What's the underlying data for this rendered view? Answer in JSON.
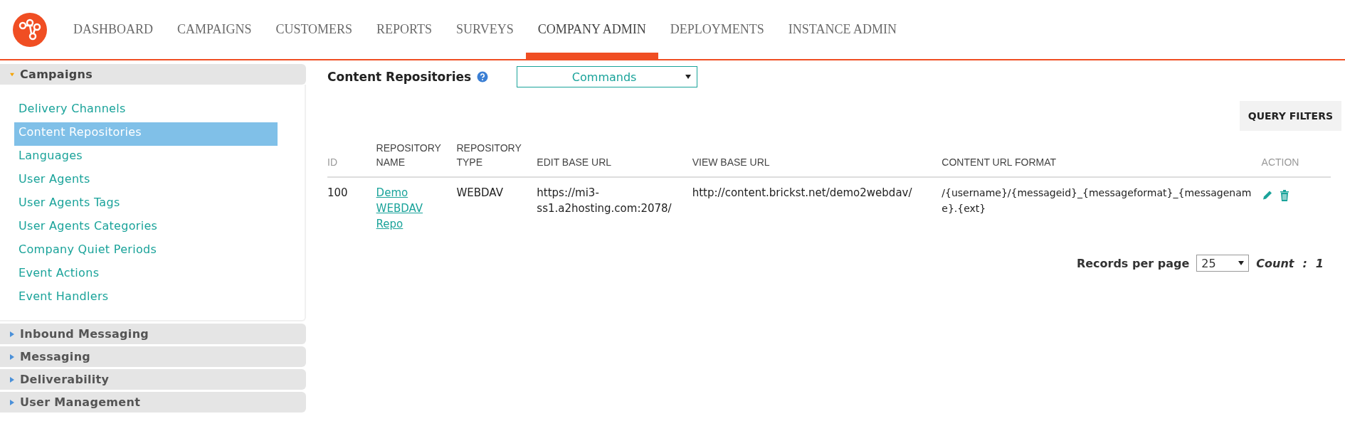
{
  "nav": {
    "tabs": [
      {
        "label": "DASHBOARD",
        "selected": false
      },
      {
        "label": "CAMPAIGNS",
        "selected": false
      },
      {
        "label": "CUSTOMERS",
        "selected": false
      },
      {
        "label": "REPORTS",
        "selected": false
      },
      {
        "label": "SURVEYS",
        "selected": false
      },
      {
        "label": "COMPANY ADMIN",
        "selected": true
      },
      {
        "label": "DEPLOYMENTS",
        "selected": false
      },
      {
        "label": "INSTANCE ADMIN",
        "selected": false
      }
    ]
  },
  "sidebar": {
    "sections": [
      {
        "title": "Campaigns",
        "expanded": true,
        "items": [
          {
            "label": "Delivery Channels",
            "selected": false
          },
          {
            "label": "Content Repositories",
            "selected": true
          },
          {
            "label": "Languages",
            "selected": false
          },
          {
            "label": "User Agents",
            "selected": false
          },
          {
            "label": "User Agents Tags",
            "selected": false
          },
          {
            "label": "User Agents Categories",
            "selected": false
          },
          {
            "label": "Company Quiet Periods",
            "selected": false
          },
          {
            "label": "Event Actions",
            "selected": false
          },
          {
            "label": "Event Handlers",
            "selected": false
          }
        ]
      },
      {
        "title": "Inbound Messaging",
        "expanded": false
      },
      {
        "title": "Messaging",
        "expanded": false
      },
      {
        "title": "Deliverability",
        "expanded": false
      },
      {
        "title": "User Management",
        "expanded": false
      }
    ]
  },
  "main": {
    "title": "Content Repositories",
    "commands": {
      "value": "Commands"
    },
    "query_filters": "QUERY FILTERS",
    "table": {
      "columns": [
        "ID",
        "REPOSITORY NAME",
        "REPOSITORY TYPE",
        "EDIT BASE URL",
        "VIEW BASE URL",
        "CONTENT URL FORMAT",
        "ACTION"
      ],
      "rows": [
        {
          "id": "100",
          "name": "Demo WEBDAV Repo",
          "type": "WEBDAV",
          "edit_base_url": "https://mi3-ss1.a2hosting.com:2078/",
          "view_base_url": "http://content.brickst.net/demo2webdav/",
          "content_url_format": "/{username}/{messageid}_{messageformat}_{messagename}.{ext}"
        }
      ]
    },
    "pagination": {
      "label": "Records per page",
      "page_size": "25",
      "count_label": "Count",
      "count_separator": ":",
      "count": "1"
    }
  }
}
